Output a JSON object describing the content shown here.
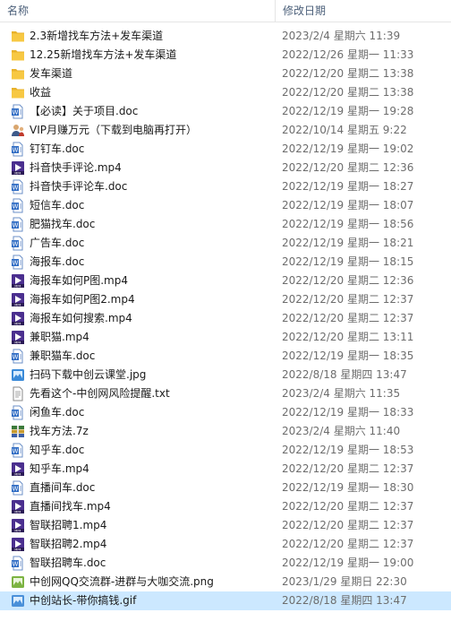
{
  "header": {
    "col_name": "名称",
    "col_date": "修改日期"
  },
  "colors": {
    "folder": "#f7c843",
    "doc": "#2f6cc4",
    "mp4": "#5a3ca0",
    "selected_bg": "#cce8ff"
  },
  "files": [
    {
      "name": "2.3新增找车方法+发车渠道",
      "date": "2023/2/4 星期六 11:39",
      "type": "folder"
    },
    {
      "name": "12.25新增找车方法+发车渠道",
      "date": "2022/12/26 星期一 11:33",
      "type": "folder"
    },
    {
      "name": "发车渠道",
      "date": "2022/12/20 星期二 13:38",
      "type": "folder"
    },
    {
      "name": "收益",
      "date": "2022/12/20 星期二 13:38",
      "type": "folder"
    },
    {
      "name": "【必读】关于项目.doc",
      "date": "2022/12/19 星期一 19:28",
      "type": "doc"
    },
    {
      "name": "VIP月赚万元（下载到电脑再打开）",
      "date": "2022/10/14 星期五 9:22",
      "type": "vip"
    },
    {
      "name": "钉钉车.doc",
      "date": "2022/12/19 星期一 19:02",
      "type": "doc"
    },
    {
      "name": "抖音快手评论.mp4",
      "date": "2022/12/20 星期二 12:36",
      "type": "mp4"
    },
    {
      "name": "抖音快手评论车.doc",
      "date": "2022/12/19 星期一 18:27",
      "type": "doc"
    },
    {
      "name": "短信车.doc",
      "date": "2022/12/19 星期一 18:07",
      "type": "doc"
    },
    {
      "name": "肥猫找车.doc",
      "date": "2022/12/19 星期一 18:56",
      "type": "doc"
    },
    {
      "name": "广告车.doc",
      "date": "2022/12/19 星期一 18:21",
      "type": "doc"
    },
    {
      "name": "海报车.doc",
      "date": "2022/12/19 星期一 18:15",
      "type": "doc"
    },
    {
      "name": "海报车如何P图.mp4",
      "date": "2022/12/20 星期二 12:36",
      "type": "mp4"
    },
    {
      "name": "海报车如何P图2.mp4",
      "date": "2022/12/20 星期二 12:37",
      "type": "mp4"
    },
    {
      "name": "海报车如何搜索.mp4",
      "date": "2022/12/20 星期二 12:37",
      "type": "mp4"
    },
    {
      "name": "兼职猫.mp4",
      "date": "2022/12/20 星期二 13:11",
      "type": "mp4"
    },
    {
      "name": "兼职猫车.doc",
      "date": "2022/12/19 星期一 18:35",
      "type": "doc"
    },
    {
      "name": "扫码下载中创云课堂.jpg",
      "date": "2022/8/18 星期四 13:47",
      "type": "jpg"
    },
    {
      "name": "先看这个-中创网风险提醒.txt",
      "date": "2023/2/4 星期六 11:35",
      "type": "txt"
    },
    {
      "name": "闲鱼车.doc",
      "date": "2022/12/19 星期一 18:33",
      "type": "doc"
    },
    {
      "name": "找车方法.7z",
      "date": "2023/2/4 星期六 11:40",
      "type": "7z"
    },
    {
      "name": "知乎车.doc",
      "date": "2022/12/19 星期一 18:53",
      "type": "doc"
    },
    {
      "name": "知乎车.mp4",
      "date": "2022/12/20 星期二 12:37",
      "type": "mp4"
    },
    {
      "name": "直播间车.doc",
      "date": "2022/12/19 星期一 18:30",
      "type": "doc"
    },
    {
      "name": "直播间找车.mp4",
      "date": "2022/12/20 星期二 12:37",
      "type": "mp4"
    },
    {
      "name": "智联招聘1.mp4",
      "date": "2022/12/20 星期二 12:37",
      "type": "mp4"
    },
    {
      "name": "智联招聘2.mp4",
      "date": "2022/12/20 星期二 12:37",
      "type": "mp4"
    },
    {
      "name": "智联招聘车.doc",
      "date": "2022/12/19 星期一 19:00",
      "type": "doc"
    },
    {
      "name": "中创网QQ交流群-进群与大咖交流.png",
      "date": "2023/1/29 星期日 22:30",
      "type": "png"
    },
    {
      "name": "中创站长-带你搞钱.gif",
      "date": "2022/8/18 星期四 13:47",
      "type": "gif",
      "selected": true
    }
  ]
}
